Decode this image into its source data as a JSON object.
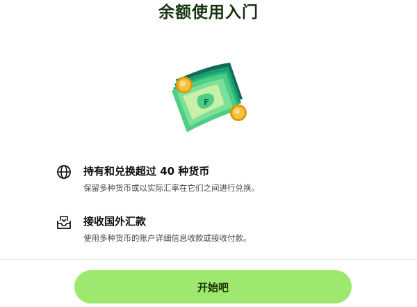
{
  "dialog": {
    "title": "余额使用入门",
    "hero_icon": "money-stack-illustration"
  },
  "features": [
    {
      "icon": "globe-icon",
      "title": "持有和兑换超过 40 种货币",
      "description": "保留多种货币或以实际汇率在它们之间进行兑换。"
    },
    {
      "icon": "inbox-receive-icon",
      "title": "接收国外汇款",
      "description": "使用多种货币的账户详细信息收款或接收付款。"
    }
  ],
  "cta": {
    "label": "开始吧",
    "color": "#9fe870",
    "text_color": "#163300"
  }
}
